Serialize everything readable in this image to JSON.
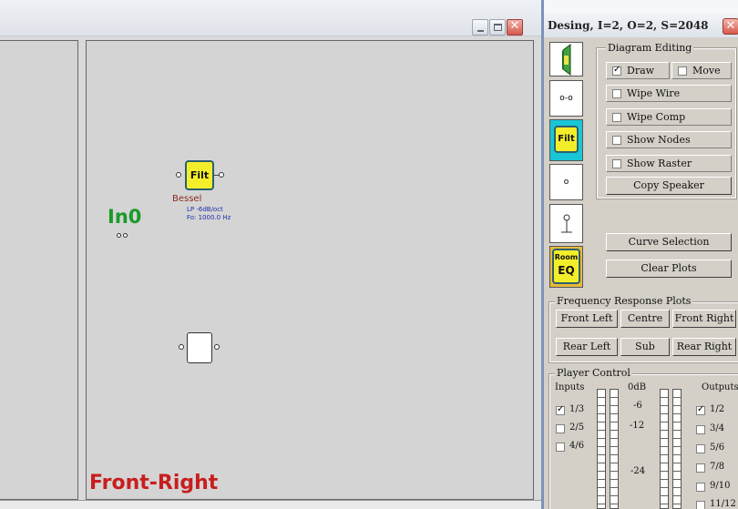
{
  "left_window": {
    "canvas": {
      "input_label": "In0",
      "filter_block": {
        "label": "Filt",
        "type": "Bessel",
        "detail_1": "LP -6dB/oct",
        "detail_2": "Fo: 1000.0 Hz"
      },
      "channel_label": "Front-Right"
    }
  },
  "right_panel": {
    "title": "Desing, I=2, O=2, S=2048",
    "close_glyph": "✕",
    "tiles": [
      {
        "name": "speaker",
        "label": ""
      },
      {
        "name": "wire",
        "label": "o-o"
      },
      {
        "name": "filter",
        "label": "Filt"
      },
      {
        "name": "node",
        "label": "o"
      },
      {
        "name": "probe",
        "label": ""
      },
      {
        "name": "room-eq",
        "label_top": "Room",
        "label_bottom": "EQ"
      }
    ],
    "diagram_editing": {
      "title": "Diagram Editing",
      "draw": {
        "label": "Draw",
        "checked": true
      },
      "move": {
        "label": "Move",
        "checked": false
      },
      "wipe_wire": {
        "label": "Wipe Wire",
        "checked": false
      },
      "wipe_comp": {
        "label": "Wipe Comp",
        "checked": false
      },
      "show_nodes": {
        "label": "Show Nodes",
        "checked": false
      },
      "show_raster": {
        "label": "Show Raster",
        "checked": false
      },
      "copy_speaker": "Copy Speaker"
    },
    "curve_selection": "Curve Selection",
    "clear_plots": "Clear Plots",
    "frequency_response": {
      "title": "Frequency Response Plots",
      "buttons": [
        "Front Left",
        "Centre",
        "Front Right",
        "Rear Left",
        "Sub",
        "Rear Right"
      ]
    },
    "player_control": {
      "title": "Player Control",
      "inputs_label": "Inputs",
      "outputs_label": "Outputs",
      "inputs": [
        {
          "label": "1/3",
          "checked": true
        },
        {
          "label": "2/5",
          "checked": false
        },
        {
          "label": "4/6",
          "checked": false
        }
      ],
      "outputs": [
        {
          "label": "1/2",
          "checked": true
        },
        {
          "label": "3/4",
          "checked": false
        },
        {
          "label": "5/6",
          "checked": false
        },
        {
          "label": "7/8",
          "checked": false
        },
        {
          "label": "9/10",
          "checked": false
        },
        {
          "label": "11/12",
          "checked": false
        }
      ],
      "meter_labels": [
        "0dB",
        "-6",
        "-12",
        "-24"
      ]
    }
  },
  "colors": {
    "block_yellow": "#f4ee2a",
    "input_green": "#1a9a2a",
    "channel_red": "#c81e1e",
    "filter_type": "#8b2a1a",
    "filter_detail": "#1d2fa8",
    "selected_tile": "#19c6d6"
  }
}
